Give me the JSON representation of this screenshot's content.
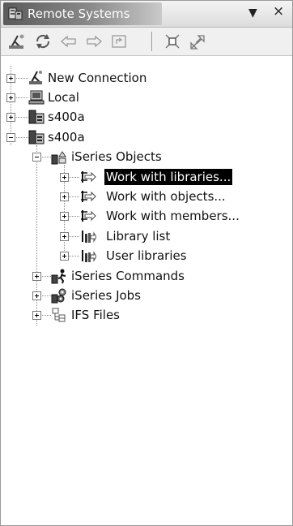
{
  "window": {
    "title": "Remote Systems",
    "menu_glyph": "▼",
    "close_glyph": "×"
  },
  "toolbar": {
    "items": [
      {
        "name": "new-connection-icon"
      },
      {
        "name": "refresh-icon"
      },
      {
        "name": "back-arrow-icon"
      },
      {
        "name": "forward-arrow-icon"
      },
      {
        "name": "home-icon"
      },
      {
        "name": "collapse-all-icon"
      },
      {
        "name": "link-with-editor-icon"
      }
    ]
  },
  "tree": {
    "items": [
      {
        "label": "New Connection",
        "icon": "new-connection-icon",
        "expanded": false,
        "selected": false
      },
      {
        "label": "Local",
        "icon": "local-computer-icon",
        "expanded": false,
        "selected": false
      },
      {
        "label": "s400a",
        "icon": "iseries-system-icon",
        "expanded": false,
        "selected": false
      },
      {
        "label": "s400a",
        "icon": "iseries-system-icon",
        "expanded": true,
        "selected": false
      },
      {
        "label": "iSeries Objects",
        "icon": "iseries-objects-icon",
        "expanded": true,
        "selected": false
      },
      {
        "label": "Work with libraries...",
        "icon": "filter-icon",
        "expanded": false,
        "selected": true
      },
      {
        "label": "Work with objects...",
        "icon": "filter-icon",
        "expanded": false,
        "selected": false
      },
      {
        "label": "Work with members...",
        "icon": "filter-icon",
        "expanded": false,
        "selected": false
      },
      {
        "label": "Library list",
        "icon": "library-list-icon",
        "expanded": false,
        "selected": false
      },
      {
        "label": "User libraries",
        "icon": "user-libraries-icon",
        "expanded": false,
        "selected": false
      },
      {
        "label": "iSeries Commands",
        "icon": "iseries-commands-icon",
        "expanded": false,
        "selected": false
      },
      {
        "label": "iSeries Jobs",
        "icon": "iseries-jobs-icon",
        "expanded": false,
        "selected": false
      },
      {
        "label": "IFS Files",
        "icon": "ifs-files-icon",
        "expanded": false,
        "selected": false
      }
    ]
  }
}
